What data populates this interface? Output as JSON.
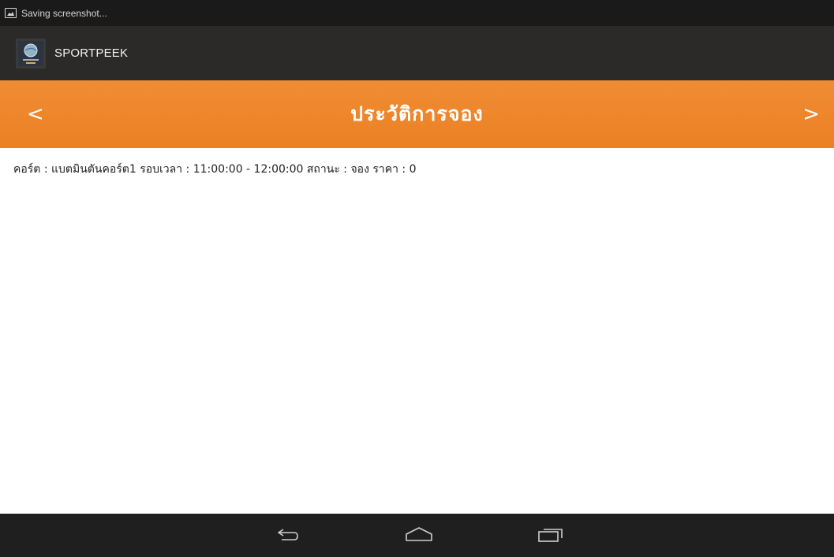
{
  "status_bar": {
    "notification_icon": "picture-icon",
    "text": "Saving screenshot..."
  },
  "action_bar": {
    "app_icon": "app-logo-icon",
    "title": "SPORTPEEK"
  },
  "header": {
    "prev_label": "<",
    "title": "ประวัติการจอง",
    "next_label": ">",
    "color": "#ED8529"
  },
  "bookings": [
    {
      "text": "คอร์ต : แบตมินตันคอร์ต1   รอบเวลา : 11:00:00 - 12:00:00   สถานะ : จอง   ราคา : 0"
    }
  ],
  "nav_bar": {
    "back_icon": "back-icon",
    "home_icon": "home-icon",
    "recent_icon": "recent-apps-icon"
  }
}
